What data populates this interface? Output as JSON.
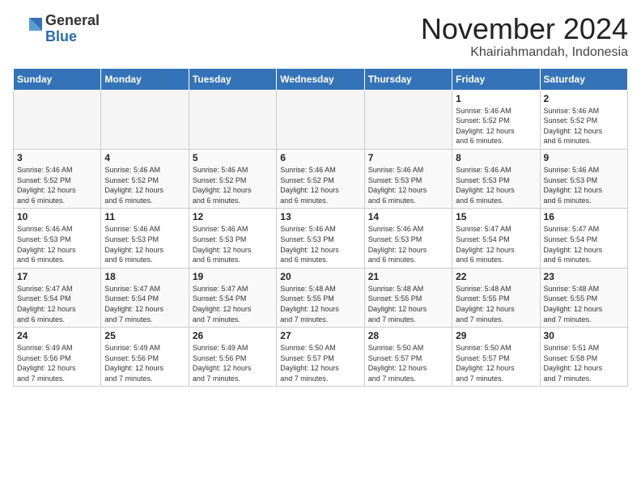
{
  "logo": {
    "general": "General",
    "blue": "Blue"
  },
  "title": "November 2024",
  "location": "Khairiahmandah, Indonesia",
  "headers": [
    "Sunday",
    "Monday",
    "Tuesday",
    "Wednesday",
    "Thursday",
    "Friday",
    "Saturday"
  ],
  "weeks": [
    [
      {
        "day": "",
        "info": ""
      },
      {
        "day": "",
        "info": ""
      },
      {
        "day": "",
        "info": ""
      },
      {
        "day": "",
        "info": ""
      },
      {
        "day": "",
        "info": ""
      },
      {
        "day": "1",
        "info": "Sunrise: 5:46 AM\nSunset: 5:52 PM\nDaylight: 12 hours\nand 6 minutes."
      },
      {
        "day": "2",
        "info": "Sunrise: 5:46 AM\nSunset: 5:52 PM\nDaylight: 12 hours\nand 6 minutes."
      }
    ],
    [
      {
        "day": "3",
        "info": "Sunrise: 5:46 AM\nSunset: 5:52 PM\nDaylight: 12 hours\nand 6 minutes."
      },
      {
        "day": "4",
        "info": "Sunrise: 5:46 AM\nSunset: 5:52 PM\nDaylight: 12 hours\nand 6 minutes."
      },
      {
        "day": "5",
        "info": "Sunrise: 5:46 AM\nSunset: 5:52 PM\nDaylight: 12 hours\nand 6 minutes."
      },
      {
        "day": "6",
        "info": "Sunrise: 5:46 AM\nSunset: 5:52 PM\nDaylight: 12 hours\nand 6 minutes."
      },
      {
        "day": "7",
        "info": "Sunrise: 5:46 AM\nSunset: 5:53 PM\nDaylight: 12 hours\nand 6 minutes."
      },
      {
        "day": "8",
        "info": "Sunrise: 5:46 AM\nSunset: 5:53 PM\nDaylight: 12 hours\nand 6 minutes."
      },
      {
        "day": "9",
        "info": "Sunrise: 5:46 AM\nSunset: 5:53 PM\nDaylight: 12 hours\nand 6 minutes."
      }
    ],
    [
      {
        "day": "10",
        "info": "Sunrise: 5:46 AM\nSunset: 5:53 PM\nDaylight: 12 hours\nand 6 minutes."
      },
      {
        "day": "11",
        "info": "Sunrise: 5:46 AM\nSunset: 5:53 PM\nDaylight: 12 hours\nand 6 minutes."
      },
      {
        "day": "12",
        "info": "Sunrise: 5:46 AM\nSunset: 5:53 PM\nDaylight: 12 hours\nand 6 minutes."
      },
      {
        "day": "13",
        "info": "Sunrise: 5:46 AM\nSunset: 5:53 PM\nDaylight: 12 hours\nand 6 minutes."
      },
      {
        "day": "14",
        "info": "Sunrise: 5:46 AM\nSunset: 5:53 PM\nDaylight: 12 hours\nand 6 minutes."
      },
      {
        "day": "15",
        "info": "Sunrise: 5:47 AM\nSunset: 5:54 PM\nDaylight: 12 hours\nand 6 minutes."
      },
      {
        "day": "16",
        "info": "Sunrise: 5:47 AM\nSunset: 5:54 PM\nDaylight: 12 hours\nand 6 minutes."
      }
    ],
    [
      {
        "day": "17",
        "info": "Sunrise: 5:47 AM\nSunset: 5:54 PM\nDaylight: 12 hours\nand 6 minutes."
      },
      {
        "day": "18",
        "info": "Sunrise: 5:47 AM\nSunset: 5:54 PM\nDaylight: 12 hours\nand 7 minutes."
      },
      {
        "day": "19",
        "info": "Sunrise: 5:47 AM\nSunset: 5:54 PM\nDaylight: 12 hours\nand 7 minutes."
      },
      {
        "day": "20",
        "info": "Sunrise: 5:48 AM\nSunset: 5:55 PM\nDaylight: 12 hours\nand 7 minutes."
      },
      {
        "day": "21",
        "info": "Sunrise: 5:48 AM\nSunset: 5:55 PM\nDaylight: 12 hours\nand 7 minutes."
      },
      {
        "day": "22",
        "info": "Sunrise: 5:48 AM\nSunset: 5:55 PM\nDaylight: 12 hours\nand 7 minutes."
      },
      {
        "day": "23",
        "info": "Sunrise: 5:48 AM\nSunset: 5:55 PM\nDaylight: 12 hours\nand 7 minutes."
      }
    ],
    [
      {
        "day": "24",
        "info": "Sunrise: 5:49 AM\nSunset: 5:56 PM\nDaylight: 12 hours\nand 7 minutes."
      },
      {
        "day": "25",
        "info": "Sunrise: 5:49 AM\nSunset: 5:56 PM\nDaylight: 12 hours\nand 7 minutes."
      },
      {
        "day": "26",
        "info": "Sunrise: 5:49 AM\nSunset: 5:56 PM\nDaylight: 12 hours\nand 7 minutes."
      },
      {
        "day": "27",
        "info": "Sunrise: 5:50 AM\nSunset: 5:57 PM\nDaylight: 12 hours\nand 7 minutes."
      },
      {
        "day": "28",
        "info": "Sunrise: 5:50 AM\nSunset: 5:57 PM\nDaylight: 12 hours\nand 7 minutes."
      },
      {
        "day": "29",
        "info": "Sunrise: 5:50 AM\nSunset: 5:57 PM\nDaylight: 12 hours\nand 7 minutes."
      },
      {
        "day": "30",
        "info": "Sunrise: 5:51 AM\nSunset: 5:58 PM\nDaylight: 12 hours\nand 7 minutes."
      }
    ]
  ]
}
